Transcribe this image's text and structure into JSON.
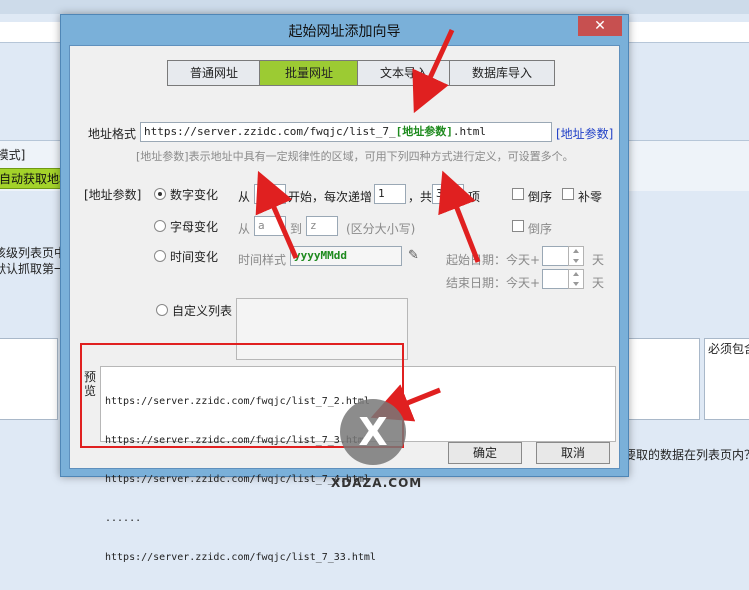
{
  "background": {
    "mode_label": "[模式]",
    "auto_fetch_button": "自动获取地址",
    "list_page_hint_1": "该级列表页中",
    "list_page_hint_2": "默认抓取第一",
    "must_include_label": "必须包含",
    "bottom_question": "要取的数据在列表页内？"
  },
  "dialog": {
    "title": "起始网址添加向导",
    "close_label": "✕",
    "tabs": [
      {
        "label": "普通网址",
        "active": false
      },
      {
        "label": "批量网址",
        "active": true
      },
      {
        "label": "文本导入",
        "active": false
      },
      {
        "label": "数据库导入",
        "active": false
      }
    ],
    "address_format": {
      "label": "地址格式",
      "value_prefix": "https://server.zzidc.com/fwqjc/list_7_",
      "value_param": "[地址参数]",
      "value_suffix": ".html",
      "param_link": "[地址参数]"
    },
    "hint": "[地址参数]表示地址中具有一定规律性的区域，可用下列四种方式进行定义，可设置多个。",
    "param_group_label": "[地址参数]",
    "numeric": {
      "label": "数字变化",
      "from_label": "从",
      "from_value": "2",
      "start_label": "开始，每次递增",
      "step_value": "1",
      "total_label": "，共",
      "count_value": "32",
      "unit": "项",
      "reverse_label": "倒序",
      "pad_label": "补零"
    },
    "letter": {
      "label": "字母变化",
      "from_label": "从",
      "from_value": "a",
      "to_label": "到",
      "to_value": "z",
      "case_label": "(区分大小写)",
      "reverse_label": "倒序"
    },
    "time": {
      "label": "时间变化",
      "style_label": "时间样式",
      "style_value": "yyyyMMdd",
      "start_label": "起始日期：今天+",
      "end_label": "结束日期：今天+",
      "day_unit": "天"
    },
    "custom_list_label": "自定义列表",
    "preview": {
      "label": "预览",
      "lines": [
        "https://server.zzidc.com/fwqjc/list_7_2.html",
        "https://server.zzidc.com/fwqjc/list_7_3.html",
        "https://server.zzidc.com/fwqjc/list_7_4.html",
        "......",
        "https://server.zzidc.com/fwqjc/list_7_33.html"
      ]
    },
    "ok_label": "确定",
    "cancel_label": "取消"
  },
  "overlay_mark": "X",
  "watermark": "XDAZA.COM",
  "colors": {
    "accent_green": "#9ccb33",
    "annotation_red": "#e02020",
    "title_blue": "#7ab0d9"
  }
}
